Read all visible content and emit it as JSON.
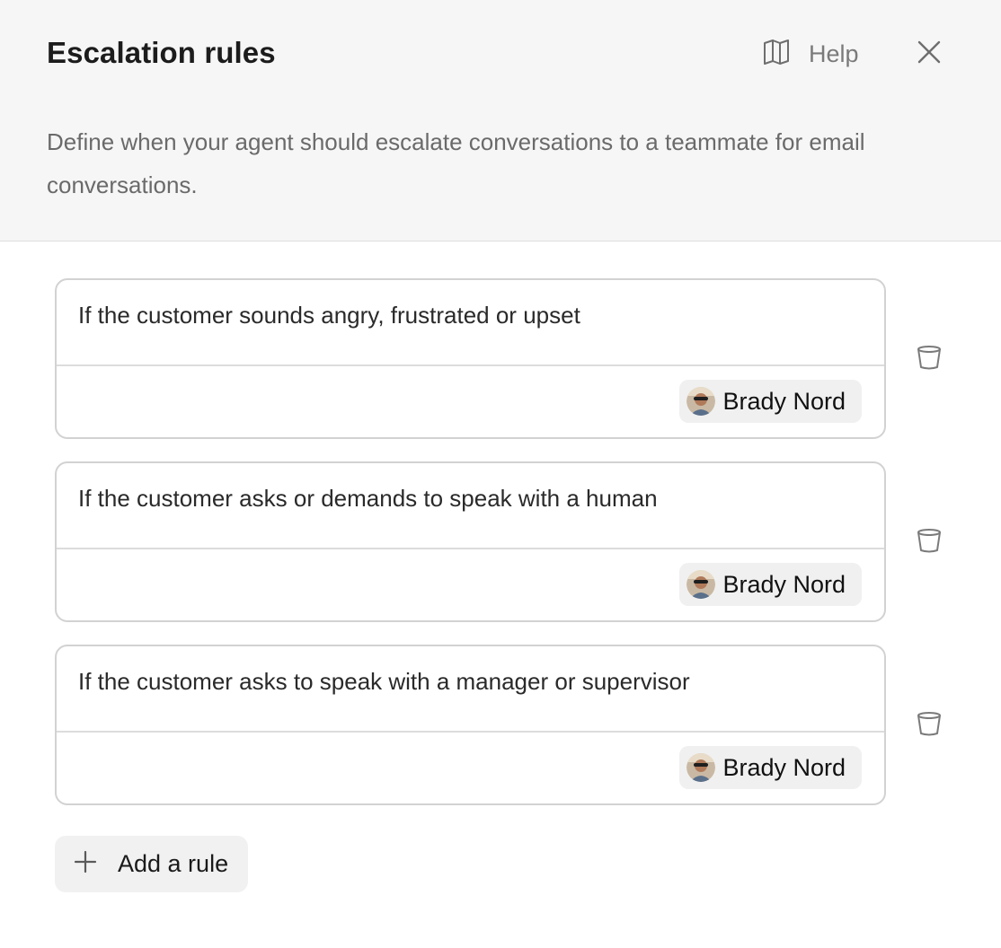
{
  "header": {
    "title": "Escalation rules",
    "help_label": "Help",
    "description": "Define when your agent should escalate conversations to a teammate for email conversations."
  },
  "rules": [
    {
      "condition": "If the customer sounds angry, frustrated or upset",
      "assignee": "Brady Nord"
    },
    {
      "condition": "If the customer asks or demands to speak with a human",
      "assignee": "Brady Nord"
    },
    {
      "condition": "If the customer asks to speak with a manager or supervisor",
      "assignee": "Brady Nord"
    }
  ],
  "add_rule_label": "Add a rule",
  "icons": {
    "help": "book-icon",
    "close": "close-icon",
    "delete": "trash-icon",
    "add": "plus-icon",
    "avatar": "avatar"
  },
  "colors": {
    "header_bg": "#f6f6f6",
    "border": "#d2d2d2",
    "chip_bg": "#f0f0f0",
    "muted_text": "#6a6a6a"
  }
}
